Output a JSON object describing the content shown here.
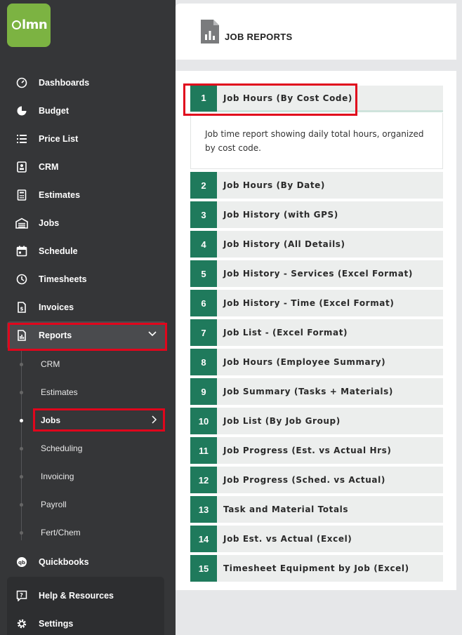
{
  "app": {
    "logo_text": "lmn",
    "colors": {
      "accent": "#1f7a5c",
      "brand": "#7cb342",
      "sidebar": "#353638",
      "highlight": "#e0061c"
    }
  },
  "sidebar": {
    "items": [
      {
        "label": "Dashboards",
        "icon": "dashboard-icon"
      },
      {
        "label": "Budget",
        "icon": "pie-chart-icon"
      },
      {
        "label": "Price List",
        "icon": "list-icon"
      },
      {
        "label": "CRM",
        "icon": "contact-card-icon"
      },
      {
        "label": "Estimates",
        "icon": "calculator-icon"
      },
      {
        "label": "Jobs",
        "icon": "garage-icon"
      },
      {
        "label": "Schedule",
        "icon": "calendar-icon"
      },
      {
        "label": "Timesheets",
        "icon": "clock-icon"
      },
      {
        "label": "Invoices",
        "icon": "invoice-icon"
      },
      {
        "label": "Reports",
        "icon": "report-icon"
      }
    ],
    "report_subitems": [
      {
        "label": "CRM"
      },
      {
        "label": "Estimates"
      },
      {
        "label": "Jobs"
      },
      {
        "label": "Scheduling"
      },
      {
        "label": "Invoicing"
      },
      {
        "label": "Payroll"
      },
      {
        "label": "Fert/Chem"
      }
    ],
    "quickbooks": {
      "label": "Quickbooks",
      "icon": "quickbooks-icon"
    },
    "bottom": [
      {
        "label": "Help & Resources",
        "icon": "help-icon"
      },
      {
        "label": "Settings",
        "icon": "gear-icon"
      }
    ]
  },
  "main": {
    "title": "JOB REPORTS",
    "expanded_description": "Job time report showing daily total hours, organized by cost code.",
    "reports": [
      {
        "num": "1",
        "label": "Job Hours (By Cost Code)"
      },
      {
        "num": "2",
        "label": "Job Hours (By Date)"
      },
      {
        "num": "3",
        "label": "Job History (with GPS)"
      },
      {
        "num": "4",
        "label": "Job History (All Details)"
      },
      {
        "num": "5",
        "label": "Job History - Services (Excel Format)"
      },
      {
        "num": "6",
        "label": "Job History - Time (Excel Format)"
      },
      {
        "num": "7",
        "label": "Job List - (Excel Format)"
      },
      {
        "num": "8",
        "label": "Job Hours (Employee Summary)"
      },
      {
        "num": "9",
        "label": "Job Summary (Tasks + Materials)"
      },
      {
        "num": "10",
        "label": "Job List (By Job Group)"
      },
      {
        "num": "11",
        "label": "Job Progress (Est. vs Actual Hrs)"
      },
      {
        "num": "12",
        "label": "Job Progress (Sched. vs Actual)"
      },
      {
        "num": "13",
        "label": "Task and Material Totals"
      },
      {
        "num": "14",
        "label": "Job Est. vs Actual (Excel)"
      },
      {
        "num": "15",
        "label": "Timesheet Equipment by Job (Excel)"
      }
    ]
  }
}
